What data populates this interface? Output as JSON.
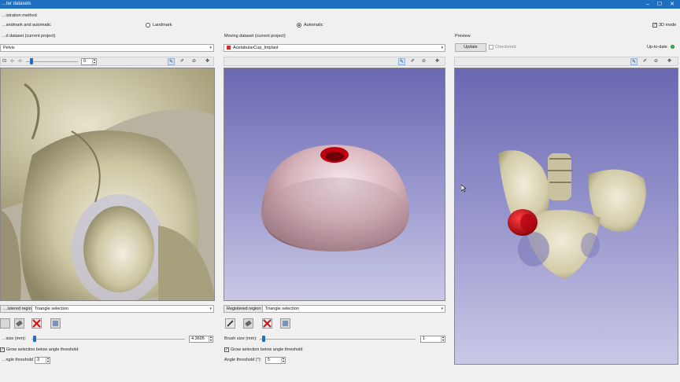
{
  "window": {
    "title": "…ter datasets"
  },
  "registration_method": {
    "label": "…istration method",
    "options": [
      "…andmark and automatic",
      "Landmark",
      "Automatic"
    ],
    "selected": "Automatic"
  },
  "mode_3d": {
    "label": "3D mode",
    "checked": true
  },
  "fixed_panel": {
    "title": "…d dataset (current project)",
    "dataset": "Pelvis",
    "slider_value": "0",
    "registered_region_label": "…istered region:",
    "registered_region_value": "Triangle selection",
    "brush_size_label": "…size (mm):",
    "brush_size_value": "4.3605",
    "grow_label": "Grow selection below angle threshold",
    "grow_checked": true,
    "angle_label": "…ngle threshold (°):",
    "angle_value": "3"
  },
  "moving_panel": {
    "title": "Moving dataset (current project)",
    "dataset": "AcetabularCup_Implant",
    "registered_region_label": "Registered region:",
    "registered_region_value": "Triangle selection",
    "brush_size_label": "Brush size (mm):",
    "brush_size_value": "1",
    "grow_label": "Grow selection below angle threshold",
    "grow_checked": true,
    "angle_label": "Angle threshold (°):",
    "angle_value": "5"
  },
  "preview_panel": {
    "title": "Preview",
    "update_label": "Update",
    "checkered_label": "Checkered",
    "status_label": "Up-to-date"
  },
  "icons": {
    "tool_brush": "brush-icon",
    "tool_eraser": "eraser-icon",
    "tool_clear": "clear-x-icon",
    "tool_fill": "fill-icon"
  },
  "colors": {
    "titlebar": "#1f6fc0",
    "bone": "#d8d2b0",
    "implant": "#d8b4bc",
    "implant_hole": "#c00010",
    "viewport_top": "#6a68b0",
    "viewport_bottom": "#c9c8e6"
  }
}
